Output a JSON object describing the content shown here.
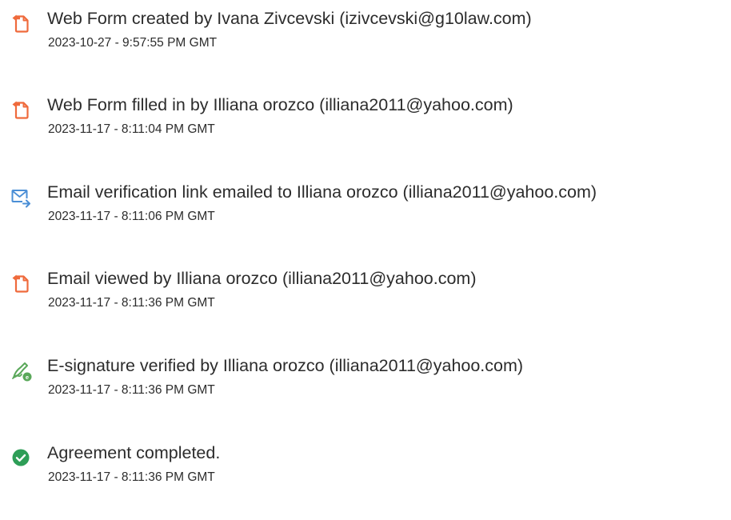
{
  "events": [
    {
      "icon": "document-icon",
      "description": "Web Form created by Ivana Zivcevski (izivcevski@g10law.com)",
      "timestamp": "2023-10-27 - 9:57:55 PM GMT"
    },
    {
      "icon": "document-icon",
      "description": "Web Form filled in by Illiana orozco (illiana2011@yahoo.com)",
      "timestamp": "2023-11-17 - 8:11:04 PM GMT"
    },
    {
      "icon": "email-send-icon",
      "description": "Email verification link emailed to Illiana orozco (illiana2011@yahoo.com)",
      "timestamp": "2023-11-17 - 8:11:06 PM GMT"
    },
    {
      "icon": "document-icon",
      "description": "Email viewed by Illiana orozco (illiana2011@yahoo.com)",
      "timestamp": "2023-11-17 - 8:11:36 PM GMT"
    },
    {
      "icon": "signature-verified-icon",
      "description": "E-signature verified by Illiana orozco (illiana2011@yahoo.com)",
      "timestamp": "2023-11-17 - 8:11:36 PM GMT"
    },
    {
      "icon": "check-circle-icon",
      "description": "Agreement completed.",
      "timestamp": "2023-11-17 - 8:11:36 PM GMT"
    }
  ],
  "colors": {
    "document_icon": "#ef6a3c",
    "email_icon": "#4b8fd6",
    "signature_icon": "#5aa85a",
    "check_icon": "#2e9e57",
    "text": "#2c2c2c"
  }
}
